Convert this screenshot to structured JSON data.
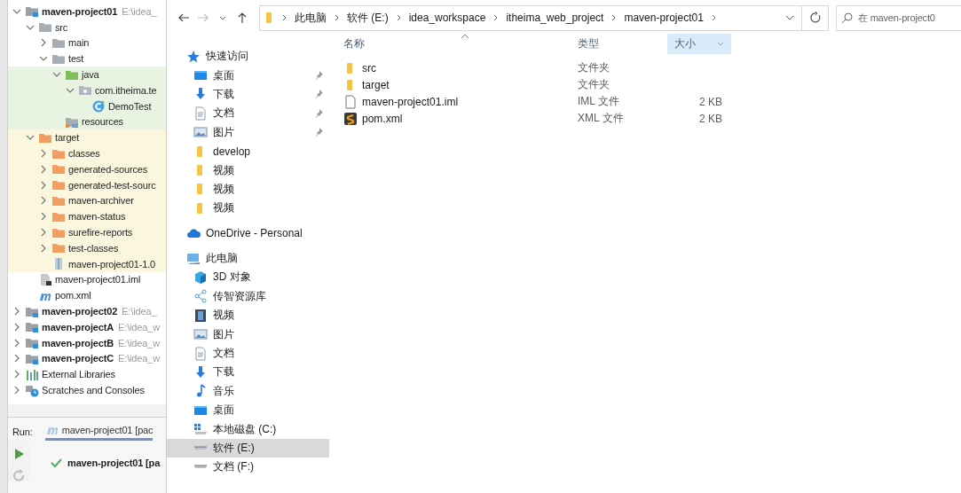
{
  "ide": {
    "project_tree": [
      {
        "label": "maven-project01",
        "hint": "E:\\idea_",
        "bold": true,
        "kind": "module",
        "expanded": true,
        "children": [
          {
            "label": "src",
            "kind": "folder",
            "expanded": true,
            "children": [
              {
                "label": "main",
                "kind": "folder",
                "expanded": false
              },
              {
                "label": "test",
                "kind": "folder",
                "expanded": true,
                "children": [
                  {
                    "label": "java",
                    "kind": "test-root",
                    "color": "#e9f3e2",
                    "expanded": true,
                    "children": [
                      {
                        "label": "com.itheima.te",
                        "kind": "package",
                        "color": "#e9f3e2",
                        "expanded": true,
                        "children": [
                          {
                            "label": "DemoTest",
                            "kind": "class",
                            "color": "#e9f3e2"
                          }
                        ]
                      }
                    ]
                  },
                  {
                    "label": "resources",
                    "kind": "resources",
                    "color": "#e9f3e2"
                  }
                ]
              }
            ]
          },
          {
            "label": "target",
            "kind": "excluded-folder",
            "color": "#fbf7df",
            "expanded": true,
            "children": [
              {
                "label": "classes",
                "kind": "excluded-folder",
                "color": "#fbf7df",
                "expanded": false
              },
              {
                "label": "generated-sources",
                "kind": "excluded-folder",
                "color": "#fbf7df",
                "expanded": false
              },
              {
                "label": "generated-test-sourc",
                "kind": "excluded-folder",
                "color": "#fbf7df",
                "expanded": false
              },
              {
                "label": "maven-archiver",
                "kind": "excluded-folder",
                "color": "#fbf7df",
                "expanded": false
              },
              {
                "label": "maven-status",
                "kind": "excluded-folder",
                "color": "#fbf7df",
                "expanded": false
              },
              {
                "label": "surefire-reports",
                "kind": "excluded-folder",
                "color": "#fbf7df",
                "expanded": false
              },
              {
                "label": "test-classes",
                "kind": "excluded-folder",
                "color": "#fbf7df",
                "expanded": false
              },
              {
                "label": "maven-project01-1.0",
                "kind": "jar",
                "color": "#fbf7df"
              }
            ]
          },
          {
            "label": "maven-project01.iml",
            "kind": "iml"
          },
          {
            "label": "pom.xml",
            "kind": "maven"
          }
        ]
      },
      {
        "label": "maven-project02",
        "hint": "E:\\idea_",
        "bold": true,
        "kind": "module",
        "expanded": false
      },
      {
        "label": "maven-projectA",
        "hint": "E:\\idea_w",
        "bold": true,
        "kind": "module",
        "expanded": false
      },
      {
        "label": "maven-projectB",
        "hint": "E:\\idea_w",
        "bold": true,
        "kind": "module",
        "expanded": false
      },
      {
        "label": "maven-projectC",
        "hint": "E:\\idea_w",
        "bold": true,
        "kind": "module",
        "expanded": false
      },
      {
        "label": "External Libraries",
        "kind": "libraries",
        "expanded": false
      },
      {
        "label": "Scratches and Consoles",
        "kind": "scratches",
        "expanded": false
      }
    ],
    "run": {
      "label": "Run:",
      "tab": "maven-project01 [pac",
      "result": "maven-project01 [pa"
    }
  },
  "explorer": {
    "breadcrumb": [
      "此电脑",
      "软件 (E:)",
      "idea_workspace",
      "itheima_web_project",
      "maven-project01"
    ],
    "search": {
      "placeholder": "在 maven-project0"
    },
    "nav": [
      {
        "label": "快速访问",
        "kind": "star",
        "pinned": false,
        "selected": false
      },
      {
        "label": "桌面",
        "kind": "desktop",
        "pinned": true,
        "selected": false
      },
      {
        "label": "下载",
        "kind": "download",
        "pinned": true,
        "selected": false
      },
      {
        "label": "文档",
        "kind": "document",
        "pinned": true,
        "selected": false
      },
      {
        "label": "图片",
        "kind": "picture",
        "pinned": true,
        "selected": false
      },
      {
        "label": "develop",
        "kind": "folder",
        "pinned": false,
        "selected": false
      },
      {
        "label": "视频",
        "kind": "folder",
        "pinned": false,
        "selected": false
      },
      {
        "label": "视频",
        "kind": "folder",
        "pinned": false,
        "selected": false
      },
      {
        "label": "视频",
        "kind": "folder",
        "pinned": false,
        "selected": false
      },
      {
        "label": "OneDrive - Personal",
        "kind": "cloud",
        "pinned": false,
        "selected": false
      },
      {
        "label": "此电脑",
        "kind": "pc",
        "pinned": false,
        "selected": false
      },
      {
        "label": "3D 对象",
        "kind": "cube",
        "pinned": false,
        "selected": false
      },
      {
        "label": "传智资源库",
        "kind": "share",
        "pinned": false,
        "selected": false
      },
      {
        "label": "视频",
        "kind": "video",
        "pinned": false,
        "selected": false
      },
      {
        "label": "图片",
        "kind": "picture",
        "pinned": false,
        "selected": false
      },
      {
        "label": "文档",
        "kind": "document",
        "pinned": false,
        "selected": false
      },
      {
        "label": "下载",
        "kind": "download",
        "pinned": false,
        "selected": false
      },
      {
        "label": "音乐",
        "kind": "music",
        "pinned": false,
        "selected": false
      },
      {
        "label": "桌面",
        "kind": "desktop",
        "pinned": false,
        "selected": false
      },
      {
        "label": "本地磁盘 (C:)",
        "kind": "system-drive",
        "pinned": false,
        "selected": false
      },
      {
        "label": "软件 (E:)",
        "kind": "drive",
        "pinned": false,
        "selected": true
      },
      {
        "label": "文档 (F:)",
        "kind": "drive",
        "pinned": false,
        "selected": false
      }
    ],
    "columns": [
      {
        "label": "名称",
        "sorted": true,
        "hovered": false
      },
      {
        "label": "类型",
        "sorted": false,
        "hovered": false
      },
      {
        "label": "大小",
        "sorted": false,
        "hovered": true
      }
    ],
    "files": [
      {
        "name": "src",
        "type": "文件夹",
        "kind": "folder"
      },
      {
        "name": "target",
        "type": "文件夹",
        "kind": "folder"
      },
      {
        "name": "maven-project01.iml",
        "type": "IML 文件",
        "size": "2 KB",
        "kind": "file"
      },
      {
        "name": "pom.xml",
        "type": "XML 文件",
        "size": "2 KB",
        "kind": "xml"
      }
    ]
  }
}
